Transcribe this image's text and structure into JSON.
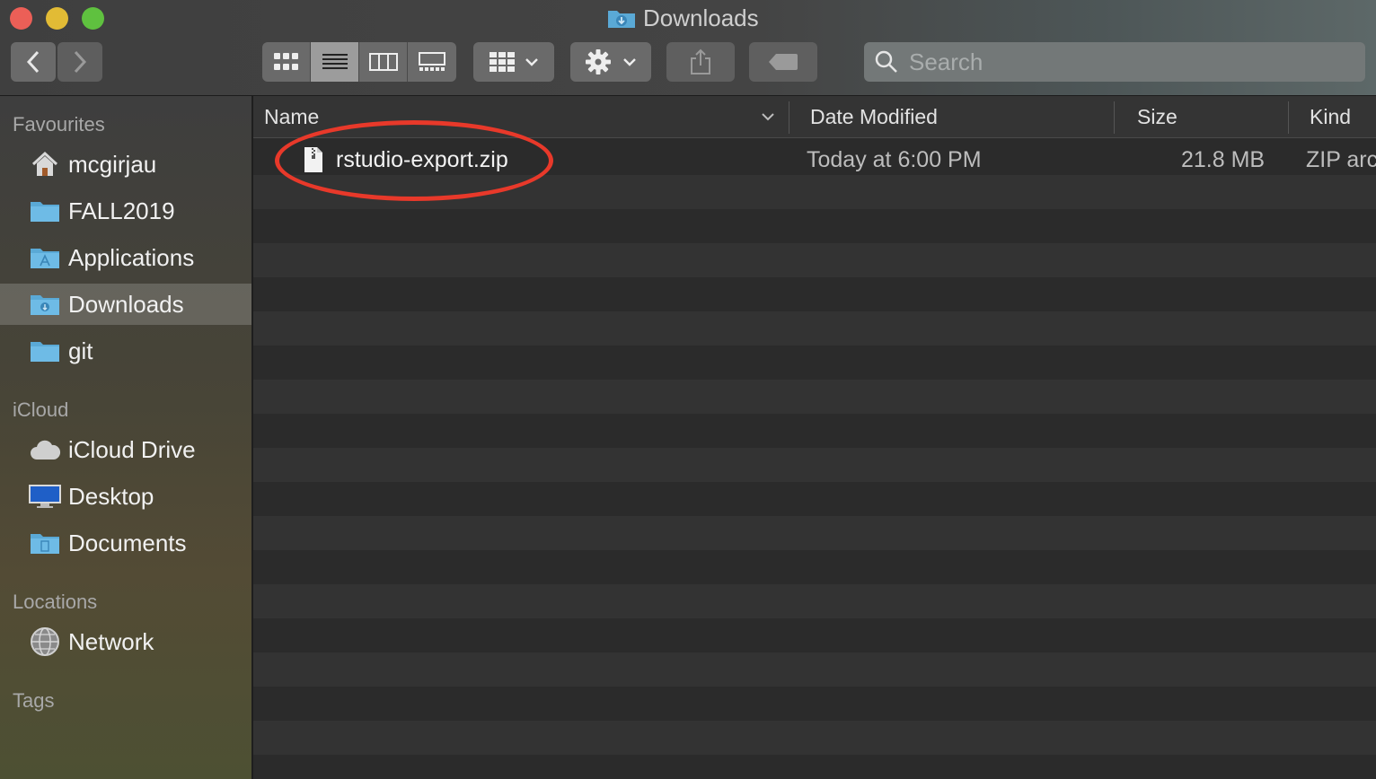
{
  "window": {
    "title": "Downloads"
  },
  "toolbar": {
    "back_icon": "chevron-left-icon",
    "forward_icon": "chevron-right-icon",
    "view_modes": [
      "icon-view",
      "list-view",
      "column-view",
      "gallery-view"
    ],
    "active_view": "list-view",
    "group_icon": "group-by-icon",
    "action_icon": "gear-icon",
    "share_icon": "share-icon",
    "tag_icon": "tag-icon"
  },
  "search": {
    "placeholder": "Search",
    "value": ""
  },
  "sidebar": {
    "favourites_header": "Favourites",
    "favourites": [
      {
        "label": "mcgirjau",
        "icon": "home-icon"
      },
      {
        "label": "FALL2019",
        "icon": "folder-icon"
      },
      {
        "label": "Applications",
        "icon": "applications-folder-icon"
      },
      {
        "label": "Downloads",
        "icon": "downloads-folder-icon",
        "selected": true
      },
      {
        "label": "git",
        "icon": "folder-icon"
      }
    ],
    "icloud_header": "iCloud",
    "icloud": [
      {
        "label": "iCloud Drive",
        "icon": "cloud-icon"
      },
      {
        "label": "Desktop",
        "icon": "desktop-icon"
      },
      {
        "label": "Documents",
        "icon": "documents-folder-icon"
      }
    ],
    "locations_header": "Locations",
    "locations": [
      {
        "label": "Network",
        "icon": "network-globe-icon"
      }
    ],
    "tags_header": "Tags"
  },
  "columns": {
    "name": "Name",
    "date": "Date Modified",
    "size": "Size",
    "kind": "Kind"
  },
  "files": [
    {
      "name": "rstudio-export.zip",
      "date": "Today at 6:00 PM",
      "size": "21.8 MB",
      "kind": "ZIP arc",
      "icon": "zip-file-icon"
    }
  ],
  "colors": {
    "annotation": "#e8392a",
    "selection": "#5a5a5a"
  }
}
